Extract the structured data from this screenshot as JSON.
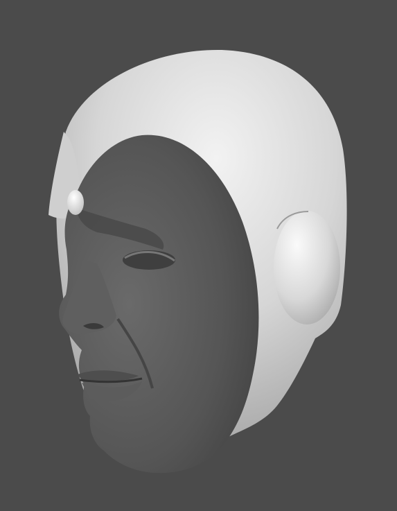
{
  "scene": {
    "subject": "sculpted-head-model",
    "background_color": "#4b4b4b",
    "helmet_color": "#d9d9d9",
    "face_color": "#555555",
    "gem_color": "#e6e6e6",
    "ear_disc_color": "#e0e0e0"
  }
}
